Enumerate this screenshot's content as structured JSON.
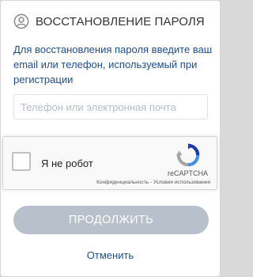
{
  "header": {
    "title": "ВОССТАНОВЛЕНИЕ ПАРОЛЯ"
  },
  "description": "Для восстановления пароля введите ваш email или телефон, используемый при регистрации",
  "contact_input": {
    "placeholder": "Телефон или электронная почта",
    "value": ""
  },
  "recaptcha": {
    "label": "Я не робот",
    "brand": "reCAPTCHA",
    "privacy": "Конфиденциальность",
    "separator": " - ",
    "terms": "Условия использования"
  },
  "continue_button": {
    "label": "ПРОДОЛЖИТЬ"
  },
  "cancel_link": {
    "label": "Отменить"
  },
  "colors": {
    "accent_text": "#1f4e8c",
    "button_disabled": "#b7c0cb",
    "title_text": "#333333"
  }
}
